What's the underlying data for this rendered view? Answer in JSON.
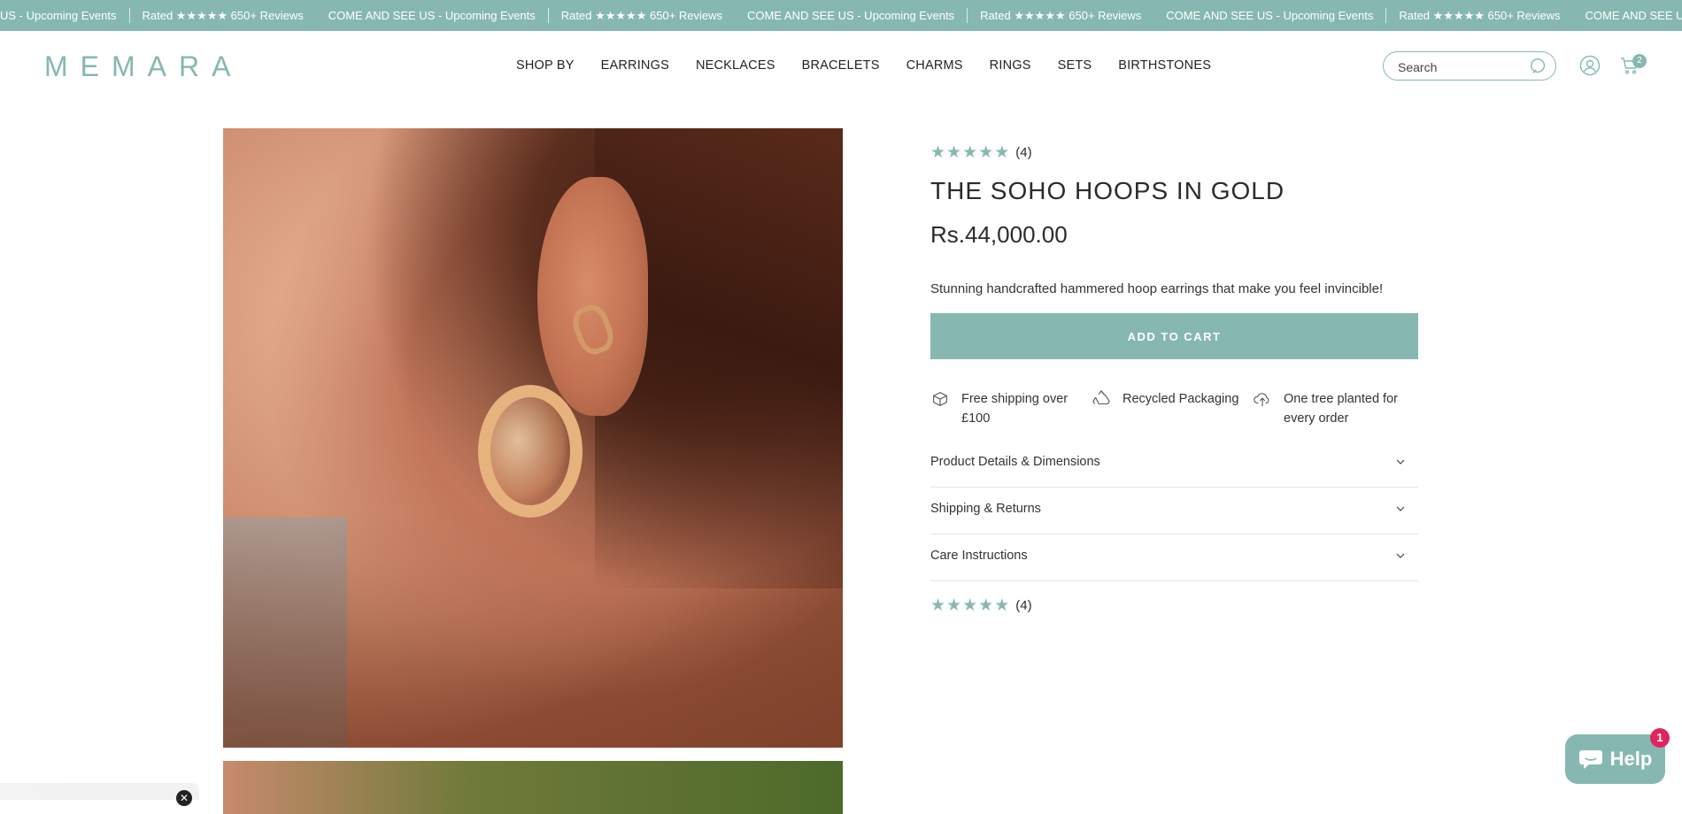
{
  "announcement": {
    "items": [
      "US - Upcoming Events",
      "Rated ★★★★★ 650+ Reviews",
      "COME AND SEE US - Upcoming Events",
      "Rated ★★★★★ 650+ Reviews",
      "COME AND SEE US - Upcoming Events",
      "Rated ★★★★★ 650+ Reviews",
      "COME AND SEE US - Upcoming Events",
      "Rated ★★★★★ 650+ Reviews",
      "COME AND SEE US - Upcoming Events"
    ]
  },
  "header": {
    "logo": "MEMARA",
    "nav": [
      "SHOP BY",
      "EARRINGS",
      "NECKLACES",
      "BRACELETS",
      "CHARMS",
      "RINGS",
      "SETS",
      "BIRTHSTONES"
    ],
    "search_placeholder": "Search",
    "cart_count": "2"
  },
  "product": {
    "review_count": "(4)",
    "rating": 5,
    "title": "THE SOHO HOOPS IN GOLD",
    "price": "Rs.44,000.00",
    "description": "Stunning handcrafted hammered hoop earrings that make you feel invincible!",
    "add_to_cart": "ADD TO CART",
    "usps": [
      {
        "icon": "box-icon",
        "line1": "Free shipping over",
        "line2": "£100"
      },
      {
        "icon": "recycle-icon",
        "line1": "Recycled Packaging",
        "line2": ""
      },
      {
        "icon": "cloud-upload-icon",
        "line1": "One tree planted for",
        "line2": "every order"
      }
    ],
    "accordions": [
      "Product Details & Dimensions",
      "Shipping & Returns",
      "Care Instructions"
    ],
    "bottom_review_count": "(4)"
  },
  "widgets": {
    "help_label": "Help",
    "help_badge": "1",
    "popup_close": "✕"
  },
  "colors": {
    "accent": "#86b8b1",
    "text": "#2b2b2b",
    "badge": "#e0245e"
  }
}
